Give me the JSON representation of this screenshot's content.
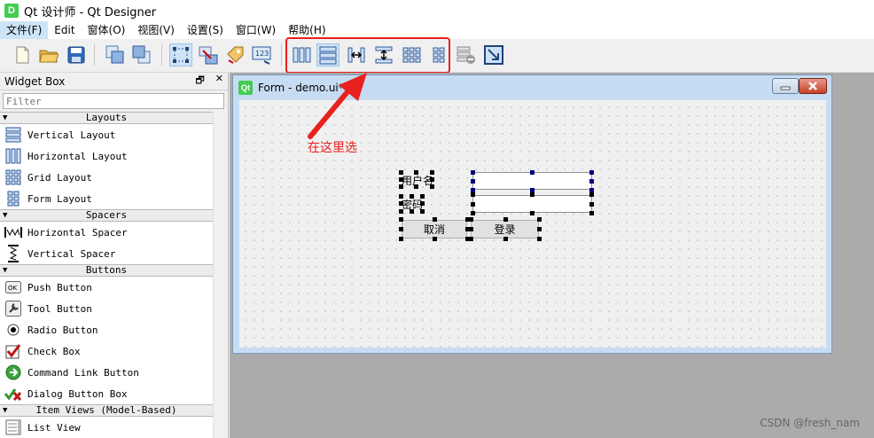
{
  "window": {
    "app_icon": "D",
    "title": "Qt 设计师 - Qt Designer"
  },
  "menu": [
    "文件(F)",
    "Edit",
    "窗体(O)",
    "视图(V)",
    "设置(S)",
    "窗口(W)",
    "帮助(H)"
  ],
  "toolbar": {
    "icons": [
      "new-file-icon",
      "open-file-icon",
      "save-icon",
      "bring-to-front-icon",
      "send-to-back-icon",
      "edit-widgets-icon",
      "edit-signals-slots-icon",
      "edit-buddies-icon",
      "edit-tab-order-icon",
      "layout-horizontal-icon",
      "layout-vertical-icon",
      "layout-horizontal-splitter-icon",
      "layout-vertical-splitter-icon",
      "layout-grid-icon",
      "layout-form-icon",
      "break-layout-icon",
      "adjust-size-icon"
    ]
  },
  "widget_box": {
    "title": "Widget Box",
    "filter_placeholder": "Filter",
    "float_glyph": "🗗",
    "close_glyph": "✕",
    "categories": [
      {
        "name": "Layouts",
        "items": [
          "Vertical Layout",
          "Horizontal Layout",
          "Grid Layout",
          "Form Layout"
        ]
      },
      {
        "name": "Spacers",
        "items": [
          "Horizontal Spacer",
          "Vertical Spacer"
        ]
      },
      {
        "name": "Buttons",
        "items": [
          "Push Button",
          "Tool Button",
          "Radio Button",
          "Check Box",
          "Command Link Button",
          "Dialog Button Box"
        ]
      },
      {
        "name": "Item Views (Model-Based)",
        "items": [
          "List View"
        ]
      }
    ]
  },
  "form_window": {
    "icon": "Qt",
    "title": "Form - demo.ui*",
    "label_username": "用户名",
    "label_password": "密码",
    "button_cancel": "取消",
    "button_login": "登录"
  },
  "annotation": "在这里选",
  "watermark": "CSDN @fresh_nam",
  "colors": {
    "annotation": "#e8211f",
    "qt_green": "#41cd52",
    "selection_handle": "#000080"
  }
}
